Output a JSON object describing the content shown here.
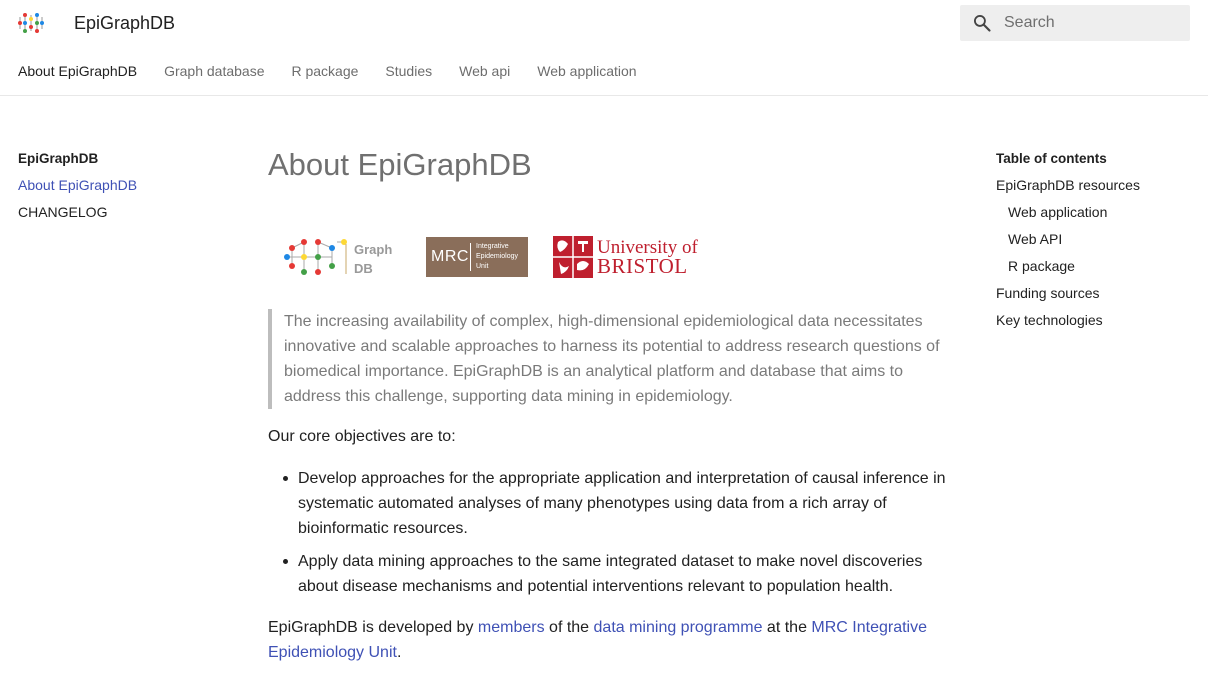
{
  "header": {
    "site_title": "EpiGraphDB",
    "search_placeholder": "Search"
  },
  "topnav": [
    {
      "label": "About EpiGraphDB"
    },
    {
      "label": "Graph database"
    },
    {
      "label": "R package"
    },
    {
      "label": "Studies"
    },
    {
      "label": "Web api"
    },
    {
      "label": "Web application"
    }
  ],
  "sidebar": {
    "title": "EpiGraphDB",
    "items": [
      {
        "label": "About EpiGraphDB"
      },
      {
        "label": "CHANGELOG"
      }
    ]
  },
  "main": {
    "title": "About EpiGraphDB",
    "logos": {
      "graphdb": "Graph DB",
      "mrc": "MRC",
      "mrc_unit": "Integrative Epidemiology Unit",
      "bristol_line1": "University of",
      "bristol_line2": "BRISTOL"
    },
    "quote": "The increasing availability of complex, high-dimensional epidemiological data necessitates innovative and scalable approaches to harness its potential to address research questions of biomedical importance. EpiGraphDB is an analytical platform and database that aims to address this challenge, supporting data mining in epidemiology.",
    "objectives_intro": "Our core objectives are to:",
    "objectives": [
      "Develop approaches for the appropriate application and interpretation of causal inference in systematic automated analyses of many phenotypes using data from a rich array of bioinformatic resources.",
      "Apply data mining approaches to the same integrated dataset to make novel discoveries about disease mechanisms and potential interventions relevant to population health."
    ],
    "dev": {
      "t1": "EpiGraphDB is developed by ",
      "link1": "members",
      "t2": " of the ",
      "link2": "data mining programme",
      "t3": " at the ",
      "link3": "MRC Integrative Epidemiology Unit",
      "t4": "."
    }
  },
  "toc": {
    "title": "Table of contents",
    "items": [
      {
        "label": "EpiGraphDB resources"
      },
      {
        "label": "Web application"
      },
      {
        "label": "Web API"
      },
      {
        "label": "R package"
      },
      {
        "label": "Funding sources"
      },
      {
        "label": "Key technologies"
      }
    ]
  },
  "colors": {
    "link": "#3f51b5",
    "mrc_brown": "#8a6e5a",
    "bristol_red": "#bf1f2e"
  }
}
